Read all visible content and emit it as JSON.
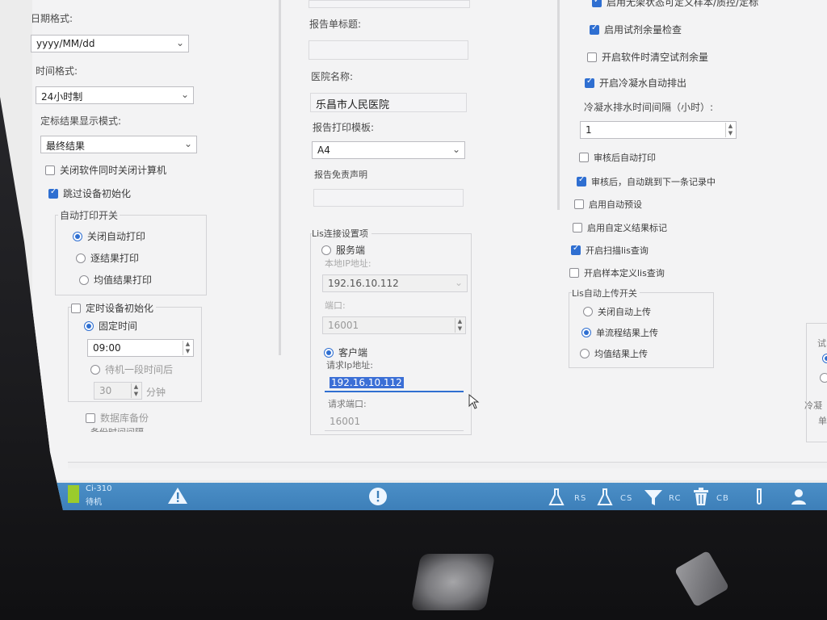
{
  "left": {
    "date_format_label": "日期格式:",
    "date_format_value": "yyyy/MM/dd",
    "time_format_label": "时间格式:",
    "time_format_value": "24小时制",
    "result_mode_label": "定标结果显示模式:",
    "result_mode_value": "最终结果",
    "close_pc_label": "关闭软件同时关闭计算机",
    "skip_init_label": "跳过设备初始化",
    "auto_print_title": "自动打印开关",
    "auto_print_options": [
      "关闭自动打印",
      "逐结果打印",
      "均值结果打印"
    ],
    "timed_init_label": "定时设备初始化",
    "fixed_time_label": "固定时间",
    "fixed_time_value": "09:00",
    "standby_label": "待机一段时间后",
    "standby_minutes": "30",
    "minutes_unit": "分钟",
    "db_backup_label": "数据库备份",
    "backup_interval_label": "备份时间间隔"
  },
  "middle": {
    "report_subtitle_label": "报告单标题:",
    "report_subtitle_value": "",
    "hospital_label": "医院名称:",
    "hospital_value": "乐昌市人民医院",
    "template_label": "报告打印模板:",
    "template_value": "A4",
    "disclaimer_label": "报告免责声明",
    "disclaimer_value": "",
    "lis_group_title": "Lis连接设置项",
    "server_label": "服务端",
    "local_ip_label": "本地IP地址:",
    "local_ip_value": "192.16.10.112",
    "port_label": "端口:",
    "port_value": "16001",
    "client_label": "客户端",
    "request_ip_label": "请求Ip地址:",
    "request_ip_value": "192.16.10.112",
    "request_port_label": "请求端口:",
    "request_port_value": "16001"
  },
  "right": {
    "top_cut_label": "启用无架状态可定义样本/质控/定标",
    "reagent_check_label": "启用试剂余量检查",
    "clear_reagent_label": "开启软件时清空试剂余量",
    "condensate_label": "开启冷凝水自动排出",
    "condensate_interval_label": "冷凝水排水时间间隔（小时）:",
    "condensate_interval_value": "1",
    "auto_print_review_label": "审核后自动打印",
    "jump_next_label": "审核后，自动跳到下一条记录中",
    "auto_preset_label": "启用自动预设",
    "custom_mark_label": "启用自定义结果标记",
    "scan_lis_label": "开启扫描lis查询",
    "sample_lis_label": "开启样本定义lis查询",
    "lis_upload_title": "Lis自动上传开关",
    "lis_upload_options": [
      "关闭自动上传",
      "单流程结果上传",
      "均值结果上传"
    ],
    "far_right_fragments": [
      "试",
      "冷凝",
      "单"
    ]
  },
  "statusbar": {
    "device_id": "Ci-310",
    "device_state": "待机",
    "labels": [
      "RS",
      "CS",
      "RC",
      "CB"
    ]
  }
}
